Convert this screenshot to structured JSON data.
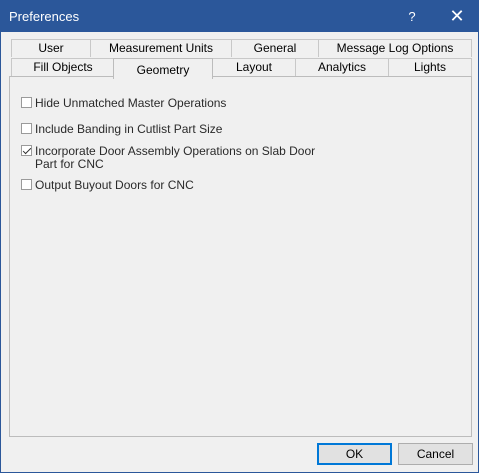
{
  "window": {
    "title": "Preferences",
    "help_label": "?",
    "close_label": "✕"
  },
  "tabs_row1": [
    {
      "label": "User"
    },
    {
      "label": "Measurement Units"
    },
    {
      "label": "General"
    },
    {
      "label": "Message Log Options"
    }
  ],
  "tabs_row2": [
    {
      "label": "Fill Objects"
    },
    {
      "label": "Geometry",
      "active": true
    },
    {
      "label": "Layout"
    },
    {
      "label": "Analytics"
    },
    {
      "label": "Lights"
    }
  ],
  "options": [
    {
      "label": "Hide Unmatched Master Operations",
      "checked": false
    },
    {
      "label": "Include Banding in Cutlist Part Size",
      "checked": false
    },
    {
      "label": "Incorporate Door Assembly Operations on Slab Door",
      "label2": "Part for CNC",
      "checked": true
    },
    {
      "label": "Output Buyout Doors for CNC",
      "checked": false
    }
  ],
  "buttons": {
    "ok": "OK",
    "cancel": "Cancel"
  }
}
